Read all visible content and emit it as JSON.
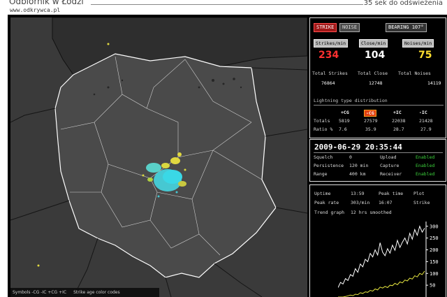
{
  "header": {
    "title": "Odbiornik w Łodzi",
    "url": "www.odkrywca.pl",
    "refresh": "35 sek do odświeżenia"
  },
  "colors": {
    "strike": "#ff3030",
    "close": "#ffffff",
    "noise": "#ffe030",
    "enabled": "#3cd23c",
    "map": "#3a3a3a"
  },
  "buttons": {
    "strike": "STRIKE",
    "noise": "NOISE",
    "bearing": "BEARING 107°"
  },
  "rates": {
    "strikes_label": "Strikes/min",
    "strikes_value": "234",
    "close_label": "Close/min",
    "close_value": "104",
    "noises_label": "Noises/min",
    "noises_value": "75"
  },
  "totals": {
    "strikes_label": "Total Strikes",
    "strikes_value": "76864",
    "close_label": "Total Close",
    "close_value": "12748",
    "noises_label": "Total Noises",
    "noises_value": "14119"
  },
  "distribution": {
    "title": "Lightning type distribution",
    "headers": [
      "+CG",
      "-CG",
      "+IC",
      "-IC"
    ],
    "totals_label": "Totals",
    "totals": [
      "5819",
      "27579",
      "22038",
      "21428"
    ],
    "ratio_label": "Ratio %",
    "ratio": [
      "7.6",
      "35.9",
      "28.7",
      "27.9"
    ]
  },
  "status": {
    "datetime": "2009-06-29 20:35:44",
    "squelch_label": "Squelch",
    "squelch_value": "0",
    "persistence_label": "Persistence",
    "persistence_value": "120 min",
    "range_label": "Range",
    "range_value": "400 km",
    "upload_label": "Upload",
    "upload_value": "Enabled",
    "capture_label": "Capture",
    "capture_value": "Enabled",
    "receiver_label": "Receiver",
    "receiver_value": "Enabled"
  },
  "stats": {
    "uptime_label": "Uptime",
    "uptime_value": "13:59",
    "peak_time_label": "Peak time",
    "peak_time_value": "16:07",
    "plot_label": "Plot",
    "plot_value": "Strike",
    "peak_rate_label": "Peak rate",
    "peak_rate_value": "303/min",
    "trend_label": "Trend graph",
    "trend_value": "12 hrs smoothed"
  },
  "chart_data": {
    "type": "line",
    "title": "",
    "xlabel": "",
    "ylabel": "",
    "yticks": [
      300,
      250,
      200,
      150,
      100,
      50
    ],
    "ylim": [
      0,
      320
    ],
    "series": [
      {
        "color": "#ffffff",
        "values": [
          40,
          62,
          55,
          78,
          70,
          95,
          88,
          120,
          105,
          140,
          128,
          160,
          150,
          185,
          170,
          200,
          178,
          230,
          190,
          175,
          205,
          186,
          220,
          198,
          240,
          210,
          232,
          250,
          225,
          270,
          245,
          286,
          262,
          300,
          275,
          292
        ]
      },
      {
        "color": "#e6e640",
        "values": [
          0,
          0,
          0,
          2,
          5,
          8,
          6,
          12,
          10,
          18,
          15,
          22,
          20,
          28,
          25,
          34,
          30,
          42,
          38,
          45,
          40,
          50,
          48,
          58,
          52,
          64,
          60,
          72,
          68,
          80,
          76,
          90,
          85,
          100,
          95,
          110
        ]
      }
    ]
  },
  "legend": {
    "symbols": "Symbols  -CG  -IC  +CG  +IC",
    "age": "Strike age color codes"
  }
}
